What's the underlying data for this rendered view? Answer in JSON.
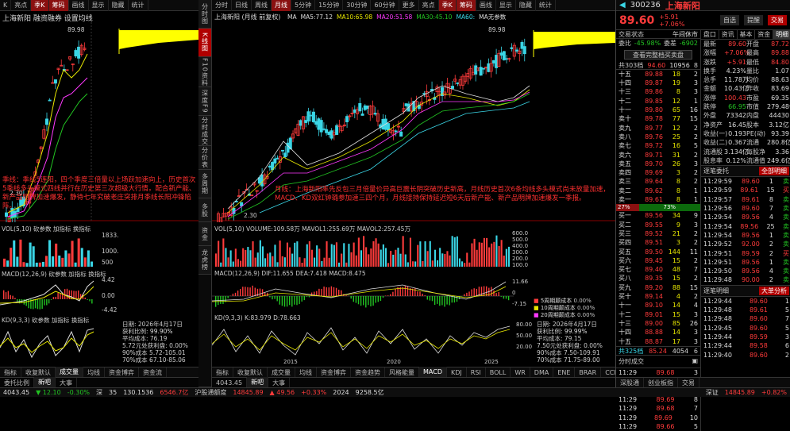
{
  "left": {
    "toolbar": [
      "K",
      "亮点",
      "",
      "季K",
      "",
      "筹码",
      "",
      "画线",
      "",
      "显示",
      "",
      "隐藏",
      "",
      "统计"
    ],
    "title": "上海新阳  融资融券  设置均线",
    "high": "89.98",
    "low": "2.30",
    "annotation": "季线：季线5连阳，四个季度三倍量以上场跃加速向上，历史首次5季线多头模式四线并行在历史第三次超级大行情，配合新产能、新产品明牌加速爆发，静待七年究破老庄突排月季线长阳冲锋陷阵。",
    "vol_label": "VOL(5,10) 砍参数  加指标  换指标",
    "vol_ticks": [
      "1833.",
      "1000.",
      "500"
    ],
    "macd_label": "MACD(12,26,9) 砍参数  加指标  换指标",
    "macd_ticks": [
      "4.42",
      "0.00",
      "-4.42"
    ],
    "kd_label": "KD(9,3,3) 砍参数  加指标  换指标",
    "info": [
      "日期: 2026年4月17日",
      "获利比例:",
      "平均成本: 76.19",
      "5.72元处获利盘: 0.00%",
      "90%成本 5.72-105.01",
      "70%成本 67.10-85.06"
    ],
    "info_pct": "99.90%",
    "bottom_tabs": [
      "指标",
      "收复默认",
      "成交量",
      "均线",
      "资金博弈",
      "资金流"
    ],
    "status": [
      "委托比例",
      "↓",
      "新吧",
      "大事",
      "",
      "26",
      "158.1",
      "6546.7亿",
      "沪股通额度"
    ]
  },
  "middle": {
    "toolbar": [
      "分时",
      "日线",
      "周线",
      "月线",
      "5分钟",
      "15分钟",
      "30分钟",
      "60分钟",
      "更多",
      "亮点",
      "季K",
      "筹码",
      "画线",
      "显示",
      "隐藏",
      "统计"
    ],
    "toolbar_active": "月线",
    "title": "上海新阳  (月线 前复权)",
    "ma_labels": [
      {
        "t": "MA",
        "v": "",
        "c": "#ddd"
      },
      {
        "t": "MA5:",
        "v": "77.12",
        "c": "#ddd"
      },
      {
        "t": "MA10:",
        "v": "65.98",
        "c": "#e6e600"
      },
      {
        "t": "MA20:",
        "v": "51.58",
        "c": "#ff39ff"
      },
      {
        "t": "MA30:",
        "v": "45.10",
        "c": "#22c322"
      },
      {
        "t": "MA60:",
        "v": "",
        "c": "#3ad6e6"
      },
      {
        "t": "MA无参数",
        "v": "",
        "c": "#ddd"
      }
    ],
    "high": "89.98",
    "low": "2.30",
    "y_ticks": [
      "90.00",
      "80.00",
      "70.00",
      "60.00",
      "50.00",
      "40.00",
      "30.00",
      "20.00",
      "10.00",
      "0"
    ],
    "annotation": "月线：上海新阳率先反包三月倍量价异高巨震长阴突破历史新高，月线历史首次6条均线多头模式尚未放量加速，MACD、KD双红钟璐参加速三四个月，月线接持保持延迟短6天后新产能、新产品明牌加速爆发一季报。",
    "vol_label": "VOL(5,10)  VOLUME:109.58万  MAVOL1:255.69万  MAVOL2:257.45万",
    "vol_ticks": [
      "600.0",
      "500.0",
      "400.0",
      "300.0",
      "200.0",
      "100.0"
    ],
    "macd_label": "MACD(12,26,9)  DIF:11.655  DEA:7.418  MACD:8.475",
    "macd_ticks": [
      "11.66",
      "0",
      "-7.15"
    ],
    "kd_label": "KD(9,3,3)  K:83.979  D:78.663",
    "kd_ticks": [
      "80.00",
      "50.00",
      "20.00"
    ],
    "legend": [
      "5周期颠成本",
      "10周期颠成本",
      "20周期颠成本"
    ],
    "legend_vals": [
      "0.00%",
      "0.00%",
      "0.00%"
    ],
    "info": [
      "日期: 2026年4月17日",
      "获利比例:",
      "平均成本: 79.15",
      "7.50元处获利盘: 0.00%",
      "90%成本 7.50-109.91",
      "70%成本 71.75-89.00"
    ],
    "info_pct": "99.99%",
    "x_ticks": [
      "2015",
      "2020",
      "2025"
    ],
    "bottom_tabs": [
      "指标",
      "收复默认",
      "成交量",
      "均线",
      "资金博弈",
      "资金趋势",
      "风格能量",
      "MACD",
      "KDJ",
      "RSI",
      "BOLL",
      "WR",
      "DMA",
      "ENE",
      "BRAR",
      "CCI",
      "更多"
    ],
    "side_tabs": [
      "分时图",
      "K线图",
      "F10资料",
      "深度F9",
      "分时成交",
      "分价表",
      "多周期",
      "多股",
      "资金",
      "龙虎榜"
    ],
    "status": [
      "4043.45",
      "▼ 12.10",
      "-0.30%",
      "",
      "深",
      "",
      "35",
      "130.1536",
      "6546.7亿",
      "沪股通额度",
      "",
      "14845.89",
      "▲ 49.56",
      "+0.33%",
      "2024",
      "9258.5亿"
    ]
  },
  "quote": {
    "code": "300236",
    "name": "上海新阳",
    "price": "89.60",
    "change": "+5.91",
    "pct": "+7.06%",
    "btns": [
      "自选",
      "提醒",
      "交易"
    ],
    "status_row": [
      "交易状态",
      "午间休市"
    ],
    "tabs": [
      "盘口",
      "资讯",
      "基本",
      "资金",
      "明细"
    ],
    "weibi": [
      "委比",
      "-45.98%",
      "委差",
      "-6902"
    ],
    "pankou_btn": "查看完整档买卖盘",
    "total_sell": [
      "共303档",
      "94.60",
      "10956",
      "8"
    ],
    "sells": [
      [
        "十五",
        "89.88",
        "18",
        "2"
      ],
      [
        "十四",
        "89.87",
        "19",
        "3"
      ],
      [
        "十三",
        "89.86",
        "8",
        "3"
      ],
      [
        "十二",
        "89.85",
        "12",
        "1"
      ],
      [
        "十一",
        "89.80",
        "65",
        "16"
      ],
      [
        "卖十",
        "89.78",
        "77",
        "15"
      ],
      [
        "卖九",
        "89.77",
        "12",
        "2"
      ],
      [
        "卖八",
        "89.76",
        "25",
        "2"
      ],
      [
        "卖七",
        "89.72",
        "16",
        "5"
      ],
      [
        "卖六",
        "89.71",
        "31",
        "2"
      ],
      [
        "卖五",
        "89.70",
        "26",
        "3"
      ],
      [
        "卖四",
        "89.69",
        "3",
        "2"
      ],
      [
        "卖三",
        "89.64",
        "8",
        "2"
      ],
      [
        "卖二",
        "89.62",
        "8",
        "1"
      ],
      [
        "卖一",
        "89.61",
        "8",
        "1"
      ]
    ],
    "ratio": [
      "27%",
      "73%"
    ],
    "buys": [
      [
        "买一",
        "89.56",
        "34",
        "9"
      ],
      [
        "买二",
        "89.55",
        "9",
        "3"
      ],
      [
        "买三",
        "89.52",
        "21",
        "2"
      ],
      [
        "买四",
        "89.51",
        "3",
        "2"
      ],
      [
        "买五",
        "89.50",
        "144",
        "11"
      ],
      [
        "买六",
        "89.45",
        "15",
        "2"
      ],
      [
        "买七",
        "89.40",
        "48",
        "7"
      ],
      [
        "买八",
        "89.35",
        "15",
        "2"
      ],
      [
        "买九",
        "89.20",
        "88",
        "15"
      ],
      [
        "买十",
        "89.14",
        "4",
        "2"
      ],
      [
        "十一",
        "89.10",
        "14",
        "4"
      ],
      [
        "十二",
        "89.01",
        "15",
        "3"
      ],
      [
        "十三",
        "89.00",
        "85",
        "26"
      ],
      [
        "十四",
        "88.88",
        "14",
        "3"
      ],
      [
        "十五",
        "88.87",
        "17",
        "3"
      ]
    ],
    "total_buy": [
      "共325档",
      "85.24",
      "4054",
      "6"
    ],
    "stats": [
      [
        "最新",
        "89.60",
        "开盘",
        "87.72"
      ],
      [
        "涨幅",
        "+7.06%",
        "最高",
        "89.88"
      ],
      [
        "涨跌",
        "+5.91",
        "最低",
        "84.80"
      ],
      [
        "换手",
        "4.23%",
        "量比",
        "1.07"
      ],
      [
        "总手",
        "11.78万",
        "均价",
        "88.63"
      ],
      [
        "金额",
        "10.43亿",
        "昨收",
        "83.69"
      ],
      [
        "涨停",
        "100.43",
        "市盈",
        "69.35"
      ],
      [
        "跌停",
        "66.95",
        "市值",
        "279.48亿"
      ],
      [
        "外盘",
        "73342",
        "内盘",
        "44430"
      ],
      [
        "净资产",
        "16.45",
        "股本",
        "3.12亿"
      ],
      [
        "收益(一)",
        "0.193",
        "PE(动)",
        "93.39"
      ],
      [
        "收益(二)",
        "0.367",
        "流通",
        "280.8亿"
      ],
      [
        "流通股",
        "3.134亿",
        "每股净",
        "3.36"
      ],
      [
        "股息率",
        "0.12%",
        "流通值",
        "249.6亿"
      ]
    ],
    "detail_title": "逐笔委托",
    "big_btn": "全部明细",
    "detail_rows": [
      [
        "11:29:59",
        "89.60",
        "1",
        "卖"
      ],
      [
        "11:29:59",
        "89.61",
        "15",
        "买"
      ],
      [
        "11:29:57",
        "89.61",
        "8",
        "卖"
      ],
      [
        "11:29:56",
        "89.60",
        "7",
        "卖"
      ],
      [
        "11:29:54",
        "89.56",
        "4",
        "卖"
      ],
      [
        "11:29:54",
        "89.56",
        "25",
        "卖"
      ],
      [
        "11:29:54",
        "89.56",
        "1",
        "卖"
      ],
      [
        "11:29:52",
        "92.00",
        "2",
        "卖"
      ],
      [
        "11:29:51",
        "89.59",
        "2",
        "买"
      ],
      [
        "11:29:51",
        "89.56",
        "1",
        "卖"
      ],
      [
        "11:29:50",
        "89.56",
        "4",
        "卖"
      ],
      [
        "11:29:48",
        "90.00",
        "2",
        "卖"
      ]
    ],
    "trade_title": "分时成交",
    "trade_rows": [
      [
        "11:29",
        "89.68",
        "3"
      ],
      [
        "11:29",
        "89.70",
        "17"
      ],
      [
        "11:29",
        "89.70",
        "3"
      ],
      [
        "11:29",
        "89.69",
        "8"
      ],
      [
        "11:29",
        "89.68",
        "7"
      ],
      [
        "11:29",
        "89.69",
        "10"
      ],
      [
        "11:29",
        "89.66",
        "5"
      ]
    ],
    "big_title": "逐笔明细",
    "big_tab": "大单分析",
    "big_rows": [
      [
        "11:29:44",
        "89.60",
        "1"
      ],
      [
        "11:29:48",
        "89.61",
        "5"
      ],
      [
        "11:29:48",
        "89.60",
        "7"
      ],
      [
        "11:29:45",
        "89.60",
        "5"
      ],
      [
        "11:29:44",
        "89.59",
        "3"
      ],
      [
        "11:29:44",
        "89.58",
        "6"
      ],
      [
        "11:29:40",
        "89.60",
        "2"
      ]
    ],
    "bottom_tabs": [
      "深股通",
      "创业板指",
      "交易"
    ],
    "status": [
      "深证",
      "",
      "14845.89",
      "▲",
      "+0.82%",
      "3655.83",
      "9258.5亿"
    ]
  }
}
